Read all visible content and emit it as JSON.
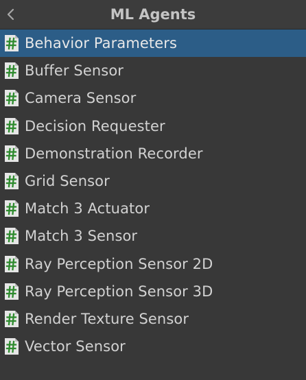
{
  "header": {
    "title": "ML Agents",
    "back_icon": "chevron-left-icon"
  },
  "colors": {
    "background": "#383838",
    "selected_row": "#2c5d87",
    "script_icon_page": "#e6e6e6",
    "script_icon_hash": "#2e8b2e"
  },
  "list": {
    "selected_index": 0,
    "items": [
      {
        "label": "Behavior Parameters",
        "icon": "csharp-script-icon"
      },
      {
        "label": "Buffer Sensor",
        "icon": "csharp-script-icon"
      },
      {
        "label": "Camera Sensor",
        "icon": "csharp-script-icon"
      },
      {
        "label": "Decision Requester",
        "icon": "csharp-script-icon"
      },
      {
        "label": "Demonstration Recorder",
        "icon": "csharp-script-icon"
      },
      {
        "label": "Grid Sensor",
        "icon": "csharp-script-icon"
      },
      {
        "label": "Match 3 Actuator",
        "icon": "csharp-script-icon"
      },
      {
        "label": "Match 3 Sensor",
        "icon": "csharp-script-icon"
      },
      {
        "label": "Ray Perception Sensor 2D",
        "icon": "csharp-script-icon"
      },
      {
        "label": "Ray Perception Sensor 3D",
        "icon": "csharp-script-icon"
      },
      {
        "label": "Render Texture Sensor",
        "icon": "csharp-script-icon"
      },
      {
        "label": "Vector Sensor",
        "icon": "csharp-script-icon"
      }
    ]
  }
}
